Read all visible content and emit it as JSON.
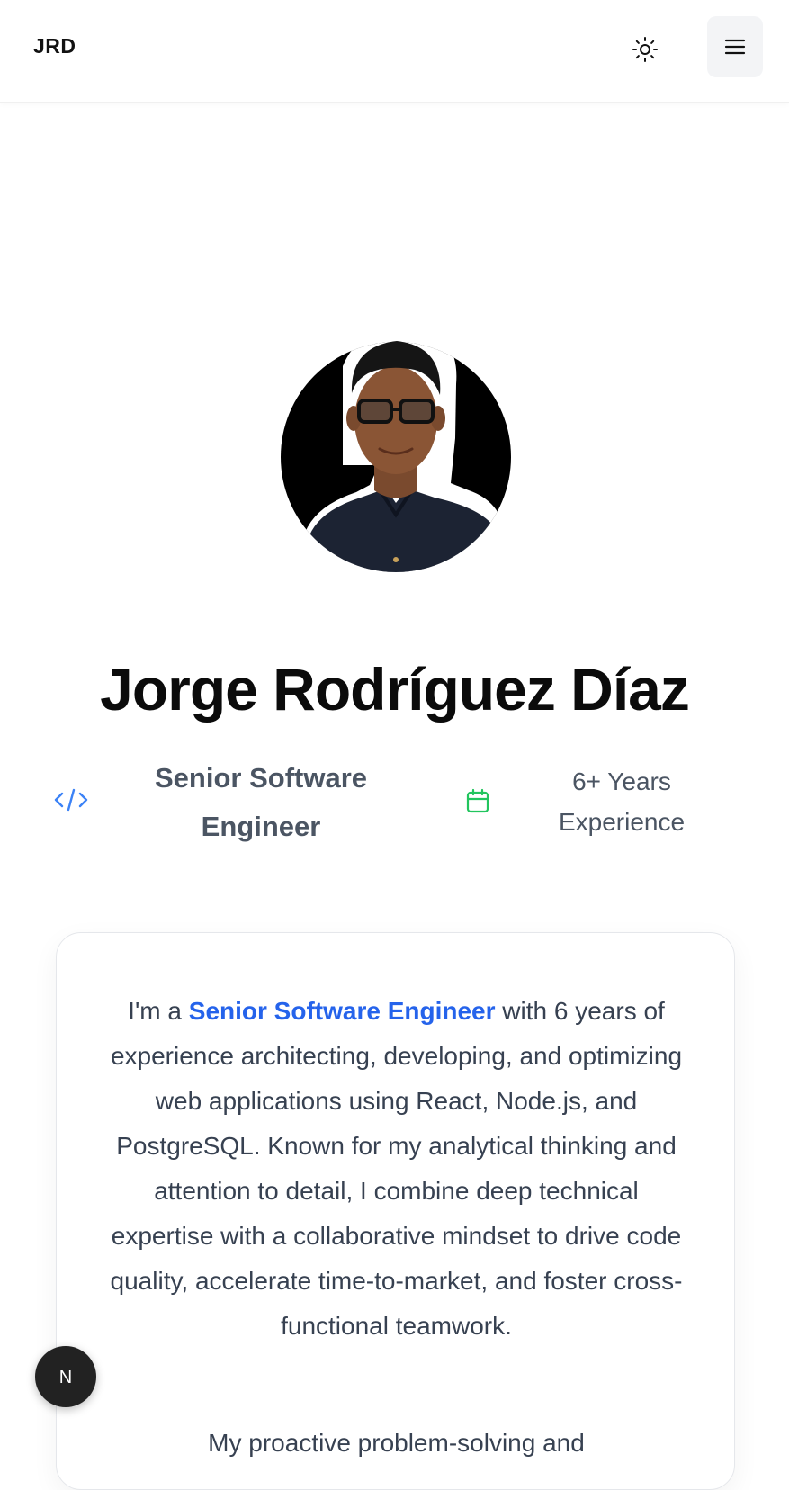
{
  "header": {
    "logo": "JRD",
    "theme_toggle_icon": "sun-icon",
    "menu_icon": "hamburger-menu-icon"
  },
  "profile": {
    "name": "Jorge Rodríguez Díaz",
    "role": "Senior Software Engineer",
    "role_icon": "code-icon",
    "experience": "6+ Years Experience",
    "experience_icon": "calendar-icon"
  },
  "bio": {
    "intro": "I'm a ",
    "highlight": "Senior Software Engineer",
    "rest": " with 6 years of experience architecting, developing, and optimizing web applications using React, Node.js, and PostgreSQL. Known for my analytical thinking and attention to detail, I combine deep technical expertise with a collaborative mindset to drive code quality, accelerate time-to-market, and foster cross-functional teamwork.",
    "second_paragraph_start": "My proactive problem-solving and"
  },
  "next_badge": {
    "label": "N"
  },
  "colors": {
    "accent": "#2563eb",
    "calendar_green": "#22c55e",
    "code_blue": "#3b82f6",
    "text_muted": "#4b5563"
  }
}
